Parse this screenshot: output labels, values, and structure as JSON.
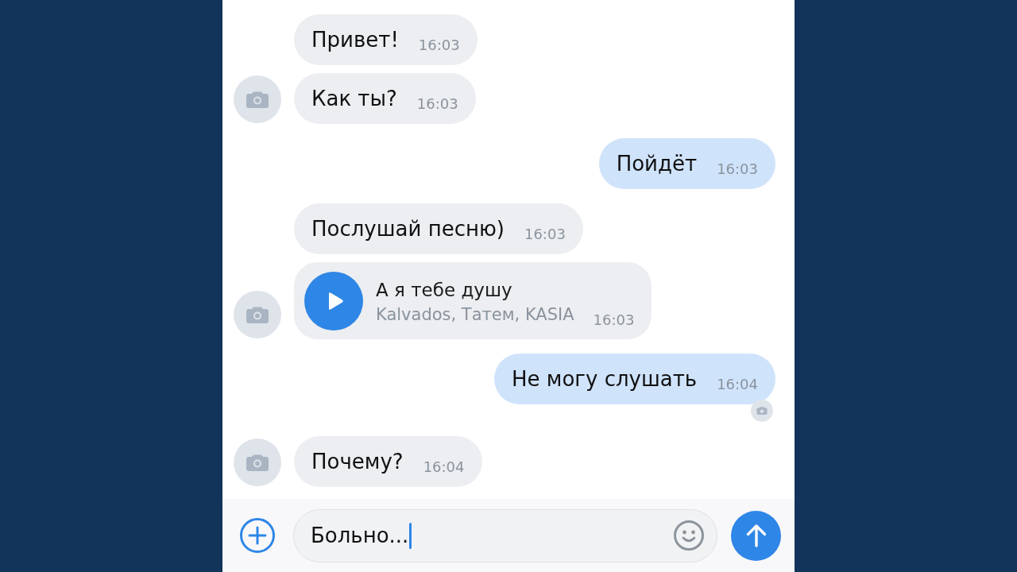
{
  "messages": [
    {
      "kind": "text",
      "outgoing": false,
      "text": "Привет!",
      "time": "16:03",
      "avatar": false,
      "seen": false
    },
    {
      "kind": "text",
      "outgoing": false,
      "text": "Как ты?",
      "time": "16:03",
      "avatar": true,
      "seen": false
    },
    {
      "kind": "text",
      "outgoing": true,
      "text": "Пойдёт",
      "time": "16:03",
      "avatar": false,
      "seen": false
    },
    {
      "kind": "text",
      "outgoing": false,
      "text": "Послушай песню)",
      "time": "16:03",
      "avatar": false,
      "seen": false
    },
    {
      "kind": "audio",
      "outgoing": false,
      "title": "А я тебе душу",
      "artist": "Kalvados, Татем, KASIA",
      "time": "16:03",
      "avatar": true,
      "seen": false
    },
    {
      "kind": "text",
      "outgoing": true,
      "text": "Не могу слушать",
      "time": "16:04",
      "avatar": false,
      "seen": true
    },
    {
      "kind": "text",
      "outgoing": false,
      "text": "Почему?",
      "time": "16:04",
      "avatar": true,
      "seen": false
    }
  ],
  "composer": {
    "value": "Больно...",
    "focused": true
  }
}
